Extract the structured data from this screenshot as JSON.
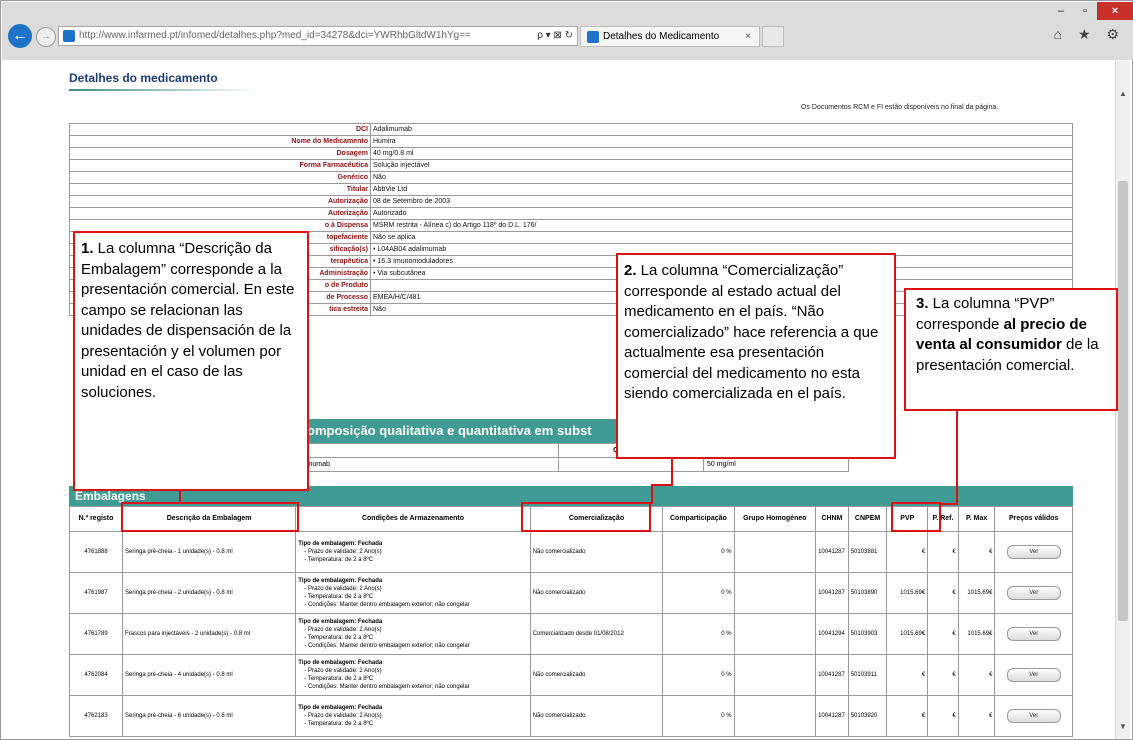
{
  "browser": {
    "url": "http://www.infarmed.pt/infomed/detalhes.php?med_id=34278&dci=YWRhbGltdW1hYg==",
    "url_tools": "ρ ▾ ⊠ ↻",
    "tab_title": "Detalhes do Medicamento",
    "tab_close": "×",
    "window_min": "–",
    "window_max": "▫",
    "window_close": "×",
    "toolbar_icons": "⌂ ★ ⚙"
  },
  "page": {
    "title": "Detalhes do medicamento",
    "docs_note": "Os Documentos RCM e FI estão disponíveis no final da página."
  },
  "info_rows": [
    {
      "label": "DCI",
      "value": "Adalimumab"
    },
    {
      "label": "Nome do Medicamento",
      "value": "Humira"
    },
    {
      "label": "Dosagem",
      "value": "40 mg/0.8 ml"
    },
    {
      "label": "Forma Farmacêutica",
      "value": "Solução injectável"
    },
    {
      "label": "Genérico",
      "value": "Não"
    },
    {
      "label": "Titular",
      "value": "AbbVie Ltd"
    },
    {
      "label": "Autorização",
      "value": "08 de Setembro de 2003"
    },
    {
      "label": "Autorização",
      "value": "Autorizado"
    },
    {
      "label": "o à Dispensa",
      "value": "MSRM restrita - Alínea c) do Artigo 118º do D.L. 176/"
    },
    {
      "label": "topefaciente",
      "value": "Não se aplica"
    },
    {
      "label": "sificação(s)",
      "value": "•  L04AB04 adalimumab"
    },
    {
      "label": "terapêutica",
      "value": "•  16.3 Imunomoduladores"
    },
    {
      "label": "Administração",
      "value": "•  Via subcutânea"
    },
    {
      "label": "o de Produto",
      "value": ""
    },
    {
      "label": "de Processo",
      "value": "EMEA/H/C/481"
    },
    {
      "label": "tica estreita",
      "value": "Não"
    }
  ],
  "composition": {
    "header": "omposição qualitativa e quantitativa em subst",
    "col_qualitativa": "Qualitativa",
    "col_quantitativa": "",
    "row_qual": "imumab",
    "row_quant": "50 mg/ml"
  },
  "embalagens": {
    "header": "Embalagens",
    "columns": [
      "N.º registo",
      "Descrição da Embalagem",
      "Condições de Armazenamento",
      "Comercialização",
      "Comparticipação",
      "Grupo Homogéneo",
      "CHNM",
      "CNPEM",
      "PVP",
      "P. Ref.",
      "P. Max",
      "Preços válidos"
    ],
    "rows": [
      {
        "registo": "4761888",
        "descricao": "Seringa pré-cheia - 1 unidade(s) - 0.8 ml",
        "cond_title": "Tipo de embalagem: Fechada",
        "cond": "- Prazo de validade: 2 Ano(s)\n- Temperatura: de 2 a 8ºC",
        "comercializacao": "Não comercializado",
        "comparticipacao": "0 %",
        "grupo": "",
        "chnm": "10041287",
        "cnpem": "50103881",
        "pvp": "€",
        "pref": "€",
        "pmax": "€",
        "btn": "Ver"
      },
      {
        "registo": "4761987",
        "descricao": "Seringa pré-cheia - 2 unidade(s) - 0.8 ml",
        "cond_title": "Tipo de embalagem: Fechada",
        "cond": "- Prazo de validade: 2 Ano(s)\n- Temperatura: de 2 a 8ºC\n- Condições: Manter dentro embalagem exterior; não congelar",
        "comercializacao": "Não comercializado",
        "comparticipacao": "0 %",
        "grupo": "",
        "chnm": "10041287",
        "cnpem": "50103890",
        "pvp": "1015.69€",
        "pref": "€",
        "pmax": "1015.69€",
        "btn": "Ver"
      },
      {
        "registo": "4761789",
        "descricao": "Frascos para injectáveis - 2 unidade(s) - 0.8 ml",
        "cond_title": "Tipo de embalagem: Fechada",
        "cond": "- Prazo de validade: 2 Ano(s)\n- Temperatura: de 2 a 8ºC\n- Condições: Manter dentro embalagem exterior; não congelar",
        "comercializacao": "Comercializado desde 01/08/2012",
        "comparticipacao": "0 %",
        "grupo": "",
        "chnm": "10041294",
        "cnpem": "50103903",
        "pvp": "1015.69€",
        "pref": "€",
        "pmax": "1015.69€",
        "btn": "Ver"
      },
      {
        "registo": "4762084",
        "descricao": "Seringa pré-cheia - 4 unidade(s) - 0.8 ml",
        "cond_title": "Tipo de embalagem: Fechada",
        "cond": "- Prazo de validade: 2 Ano(s)\n- Temperatura: de 2 a 8ºC\n- Condições: Manter dentro embalagem exterior; não congelar",
        "comercializacao": "Não comercializado",
        "comparticipacao": "0 %",
        "grupo": "",
        "chnm": "10041287",
        "cnpem": "50103911",
        "pvp": "€",
        "pref": "€",
        "pmax": "€",
        "btn": "Ver"
      },
      {
        "registo": "4762183",
        "descricao": "Seringa pré-cheia - 6 unidade(s) - 0.8 ml",
        "cond_title": "Tipo de embalagem: Fechada",
        "cond": "- Prazo de validade: 2 Ano(s)\n- Temperatura: de 2 a 8ºC",
        "comercializacao": "Não comercializado",
        "comparticipacao": "0 %",
        "grupo": "",
        "chnm": "10041287",
        "cnpem": "50103920",
        "pvp": "€",
        "pref": "€",
        "pmax": "€",
        "btn": "Ver"
      }
    ]
  },
  "callouts": {
    "c1_num": "1.",
    "c1_text": " La columna “Descrição da Embalagem” corresponde a la presentación comercial. En este campo se relacionan las unidades de dispensación de la presentación y el volumen por unidad en el caso de las soluciones.",
    "c2_num": "2.",
    "c2_text": " La columna “Comercialização” corresponde al estado actual del medicamento en el país. “Não comercializado” hace referencia a que actualmente esa presentación comercial del medicamento no esta siendo comercializada en el país.",
    "c3_num": "3.",
    "c3_text_a": " La columna “PVP” corresponde ",
    "c3_text_bold": "al precio de venta al consumidor",
    "c3_text_b": " de la presentación comercial."
  },
  "colors": {
    "teal_header": "#3f9b93",
    "callout_border": "#dd1111",
    "label_text": "#8a1212"
  }
}
